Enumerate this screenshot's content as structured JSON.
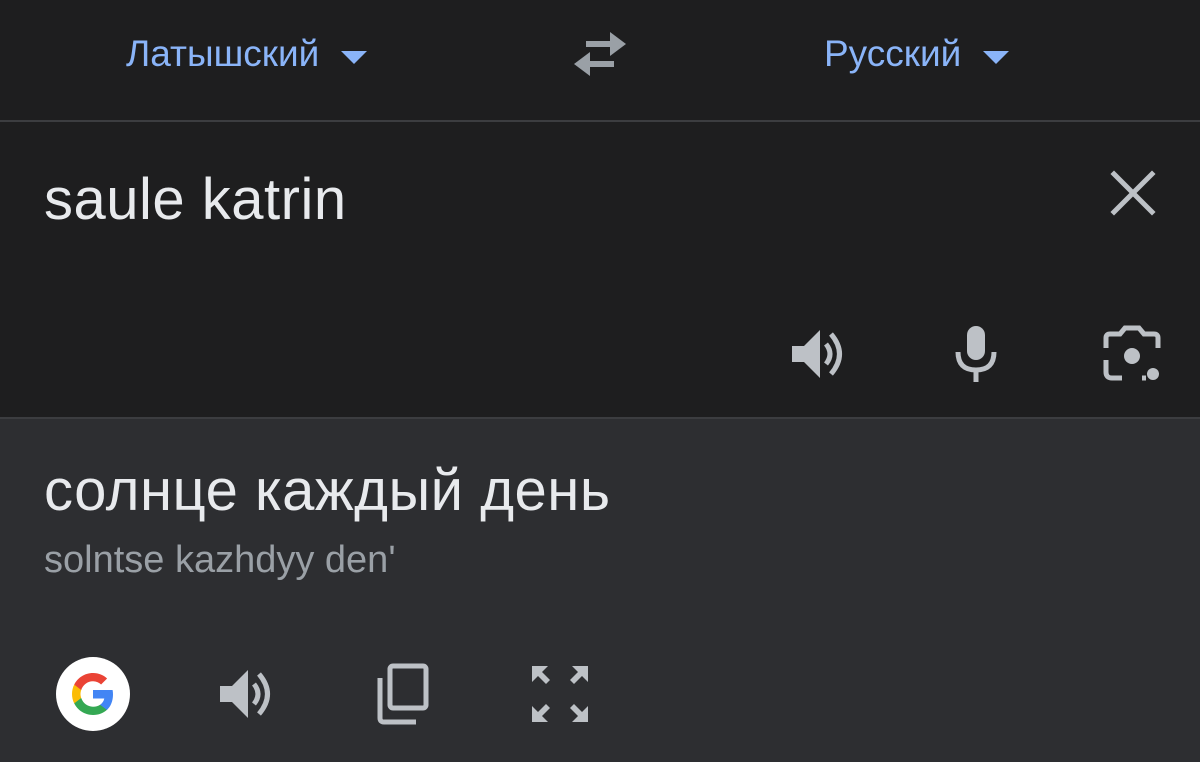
{
  "languages": {
    "source": "Латышский",
    "target": "Русский"
  },
  "input": {
    "text": "saule katrin"
  },
  "output": {
    "translation": "солнце каждый день",
    "transliteration": "solntse kazhdyy den'"
  },
  "icons": {
    "swap": "swap-arrows-icon",
    "clear": "close-icon",
    "speak_input": "speaker-icon",
    "mic": "microphone-icon",
    "camera": "camera-lens-icon",
    "google": "google-logo-icon",
    "speak_output": "speaker-icon",
    "copy": "copy-icon",
    "fullscreen": "fullscreen-icon"
  },
  "colors": {
    "accent": "#8ab4f8",
    "icon": "#bdc1c6",
    "text": "#e8eaed",
    "subtext": "#9aa0a6",
    "input_bg": "#1e1e1f",
    "output_bg": "#2d2e31"
  }
}
